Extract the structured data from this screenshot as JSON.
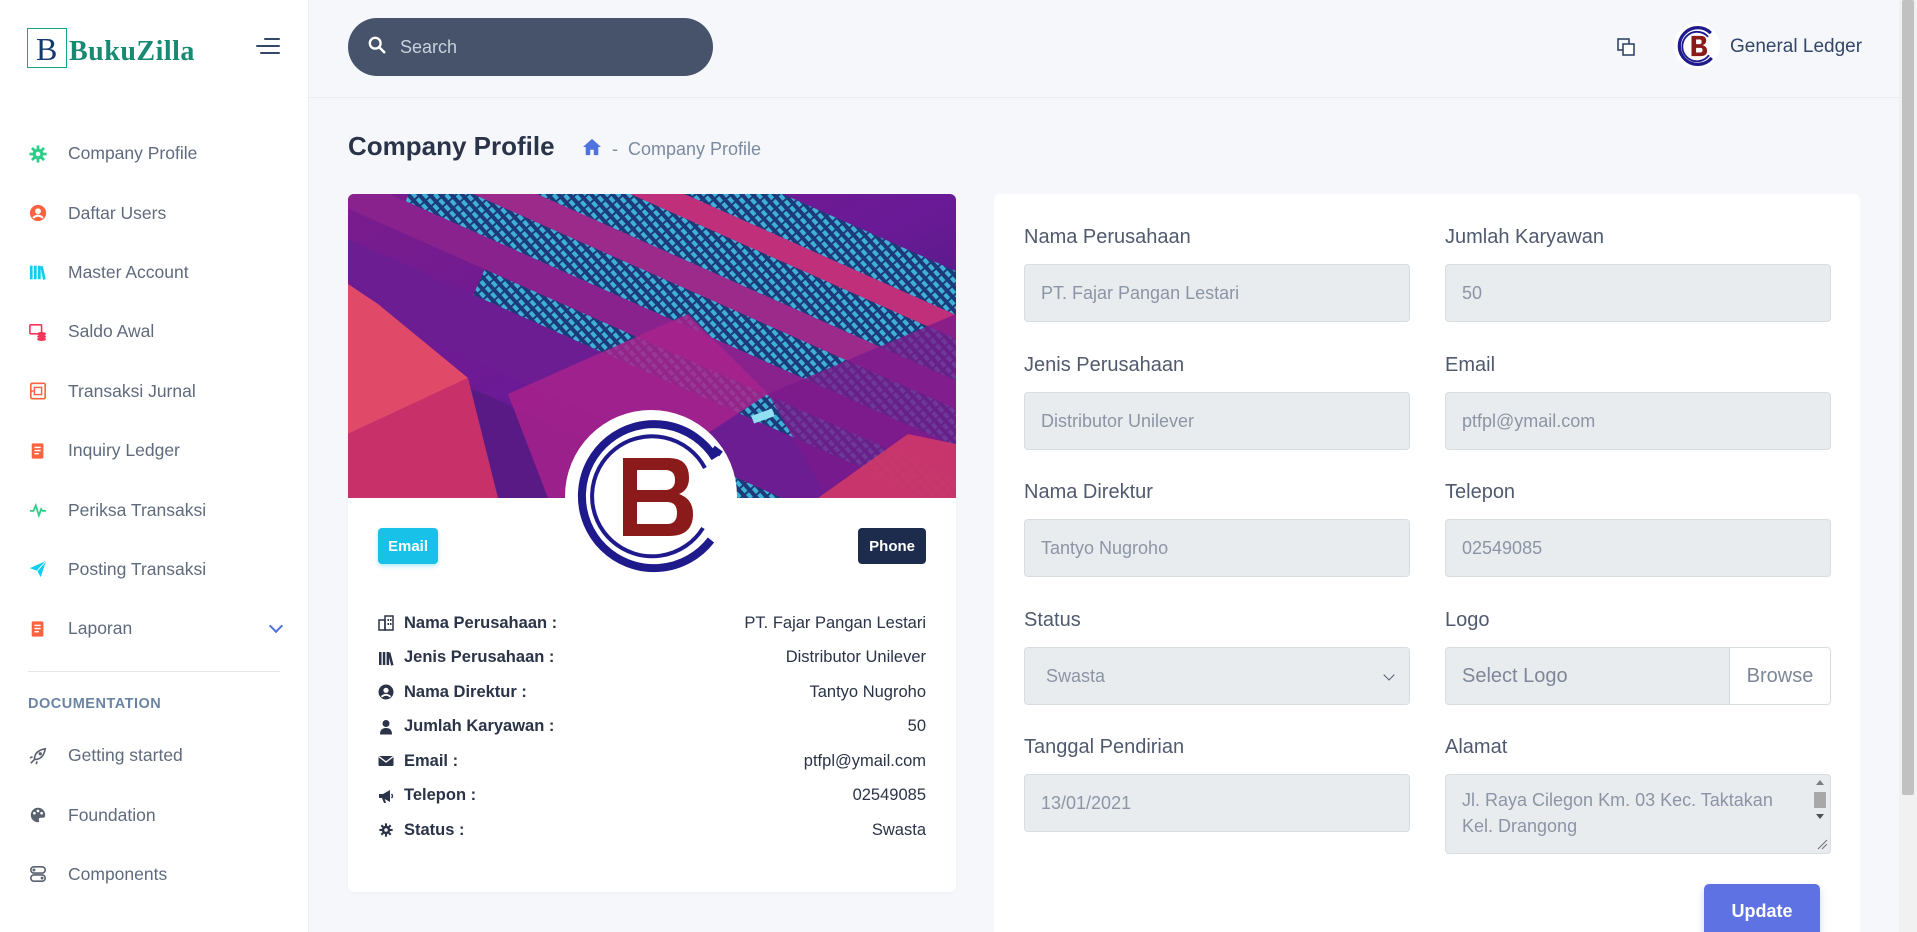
{
  "app": {
    "brand_letter": "B",
    "brand_name": "BukuZilla"
  },
  "sidebar": {
    "items": [
      {
        "label": "Company Profile",
        "icon": "gear-icon",
        "color": "#2dce89"
      },
      {
        "label": "Daftar Users",
        "icon": "user-circle-icon",
        "color": "#f5365c"
      },
      {
        "label": "Master Account",
        "icon": "books-icon",
        "color": "#11cdef"
      },
      {
        "label": "Saldo Awal",
        "icon": "coins-icon",
        "color": "#f5365c"
      },
      {
        "label": "Transaksi Jurnal",
        "icon": "receipt-icon",
        "color": "#fb6340"
      },
      {
        "label": "Inquiry Ledger",
        "icon": "document-icon",
        "color": "#fb6340"
      },
      {
        "label": "Periksa Transaksi",
        "icon": "pulse-icon",
        "color": "#2dce89"
      },
      {
        "label": "Posting Transaksi",
        "icon": "send-icon",
        "color": "#11cdef"
      },
      {
        "label": "Laporan",
        "icon": "report-icon",
        "color": "#fb6340"
      }
    ],
    "doc_heading": "DOCUMENTATION",
    "doc_items": [
      {
        "label": "Getting started",
        "icon": "rocket-icon"
      },
      {
        "label": "Foundation",
        "icon": "palette-icon"
      },
      {
        "label": "Components",
        "icon": "components-icon"
      }
    ]
  },
  "topbar": {
    "search_placeholder": "Search",
    "user_name": "General Ledger"
  },
  "page": {
    "title": "Company Profile",
    "breadcrumb_sep": "-",
    "breadcrumb_current": "Company Profile"
  },
  "profile": {
    "email_button": "Email",
    "phone_button": "Phone",
    "rows": [
      {
        "label": "Nama Perusahaan :",
        "value": "PT. Fajar Pangan Lestari",
        "icon": "building-icon"
      },
      {
        "label": "Jenis Perusahaan :",
        "value": "Distributor Unilever",
        "icon": "books-icon"
      },
      {
        "label": "Nama Direktur :",
        "value": "Tantyo Nugroho",
        "icon": "user-circle-icon"
      },
      {
        "label": "Jumlah Karyawan :",
        "value": "50",
        "icon": "user-icon"
      },
      {
        "label": "Email :",
        "value": "ptfpl@ymail.com",
        "icon": "envelope-icon"
      },
      {
        "label": "Telepon :",
        "value": "02549085",
        "icon": "megaphone-icon"
      },
      {
        "label": "Status :",
        "value": "Swasta",
        "icon": "gear-icon"
      }
    ]
  },
  "form": {
    "nama_perusahaan": {
      "label": "Nama Perusahaan",
      "value": "PT. Fajar Pangan Lestari"
    },
    "jumlah_karyawan": {
      "label": "Jumlah Karyawan",
      "value": "50"
    },
    "jenis_perusahaan": {
      "label": "Jenis Perusahaan",
      "value": "Distributor Unilever"
    },
    "email": {
      "label": "Email",
      "value": "ptfpl@ymail.com"
    },
    "nama_direktur": {
      "label": "Nama Direktur",
      "value": "Tantyo Nugroho"
    },
    "telepon": {
      "label": "Telepon",
      "value": "02549085"
    },
    "status": {
      "label": "Status",
      "value": "Swasta"
    },
    "logo": {
      "label": "Logo",
      "placeholder": "Select Logo",
      "browse": "Browse"
    },
    "tanggal_pendirian": {
      "label": "Tanggal Pendirian",
      "value": "13/01/2021"
    },
    "alamat": {
      "label": "Alamat",
      "value": "Jl. Raya Cilegon Km. 03 Kec. Taktakan Kel. Drangong"
    },
    "update_button": "Update"
  },
  "colors": {
    "accent": "#5e72e4",
    "info": "#18c1e8",
    "dark": "#1d2b4c",
    "logo_red": "#8b1a1a",
    "logo_blue": "#1f1a8c"
  }
}
